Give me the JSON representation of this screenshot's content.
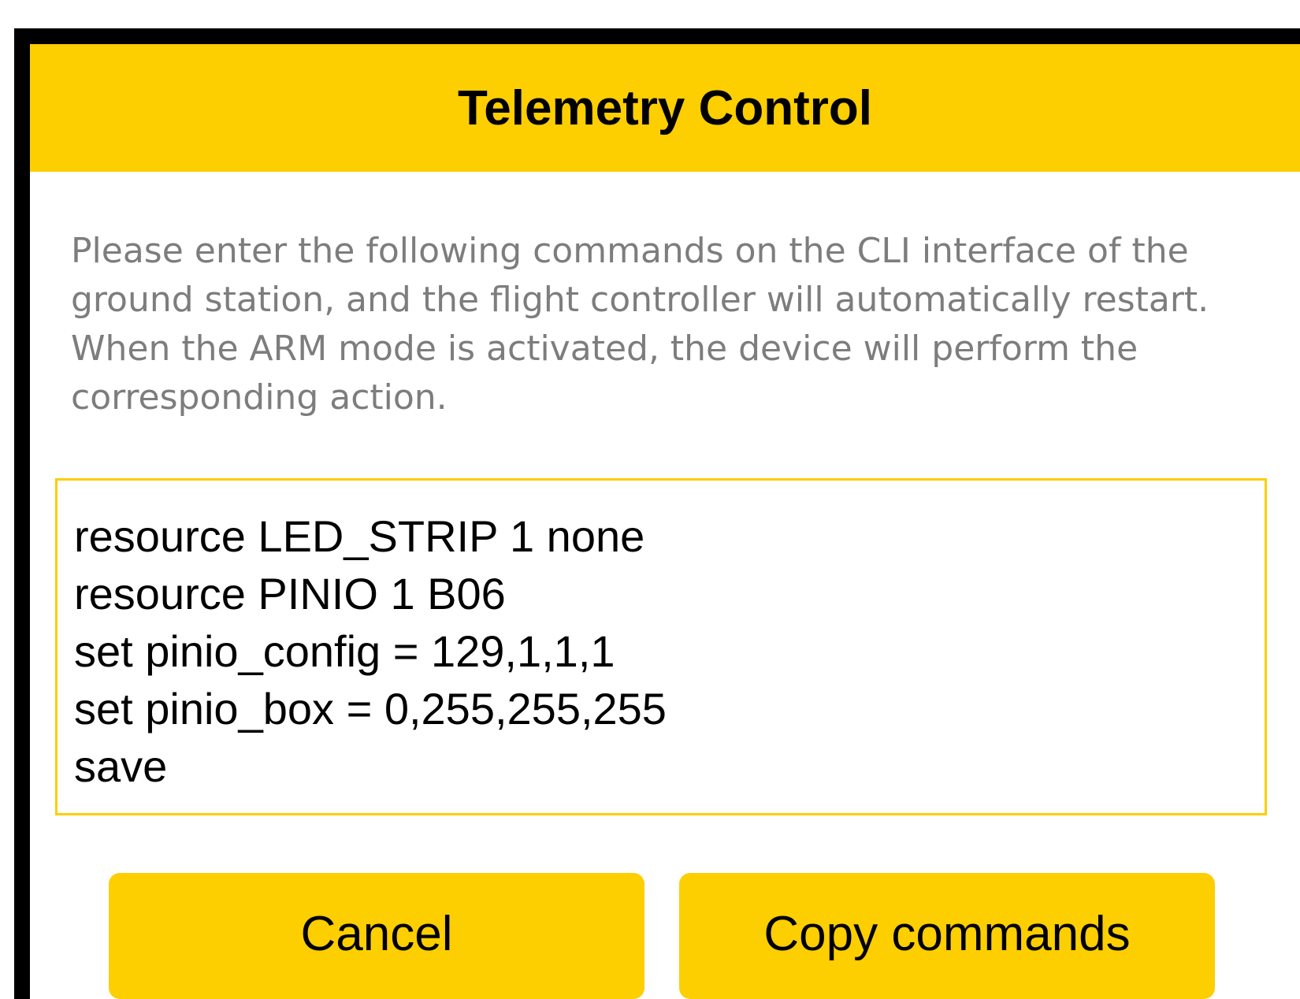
{
  "dialog": {
    "title": "Telemetry Control",
    "message": "Please enter the following commands on the CLI interface of the ground station, and the flight controller will automatically restart. When the ARM mode is activated, the device will perform the corresponding action.",
    "commands": [
      "resource LED_STRIP 1 none",
      "resource PINIO 1 B06",
      "set pinio_config = 129,1,1,1",
      "set pinio_box = 0,255,255,255",
      "save"
    ],
    "buttons": {
      "cancel_label": "Cancel",
      "copy_label": "Copy commands"
    }
  },
  "colors": {
    "accent": "#FDCE00",
    "message_text": "#7D7D7D",
    "backdrop": "#000000"
  }
}
